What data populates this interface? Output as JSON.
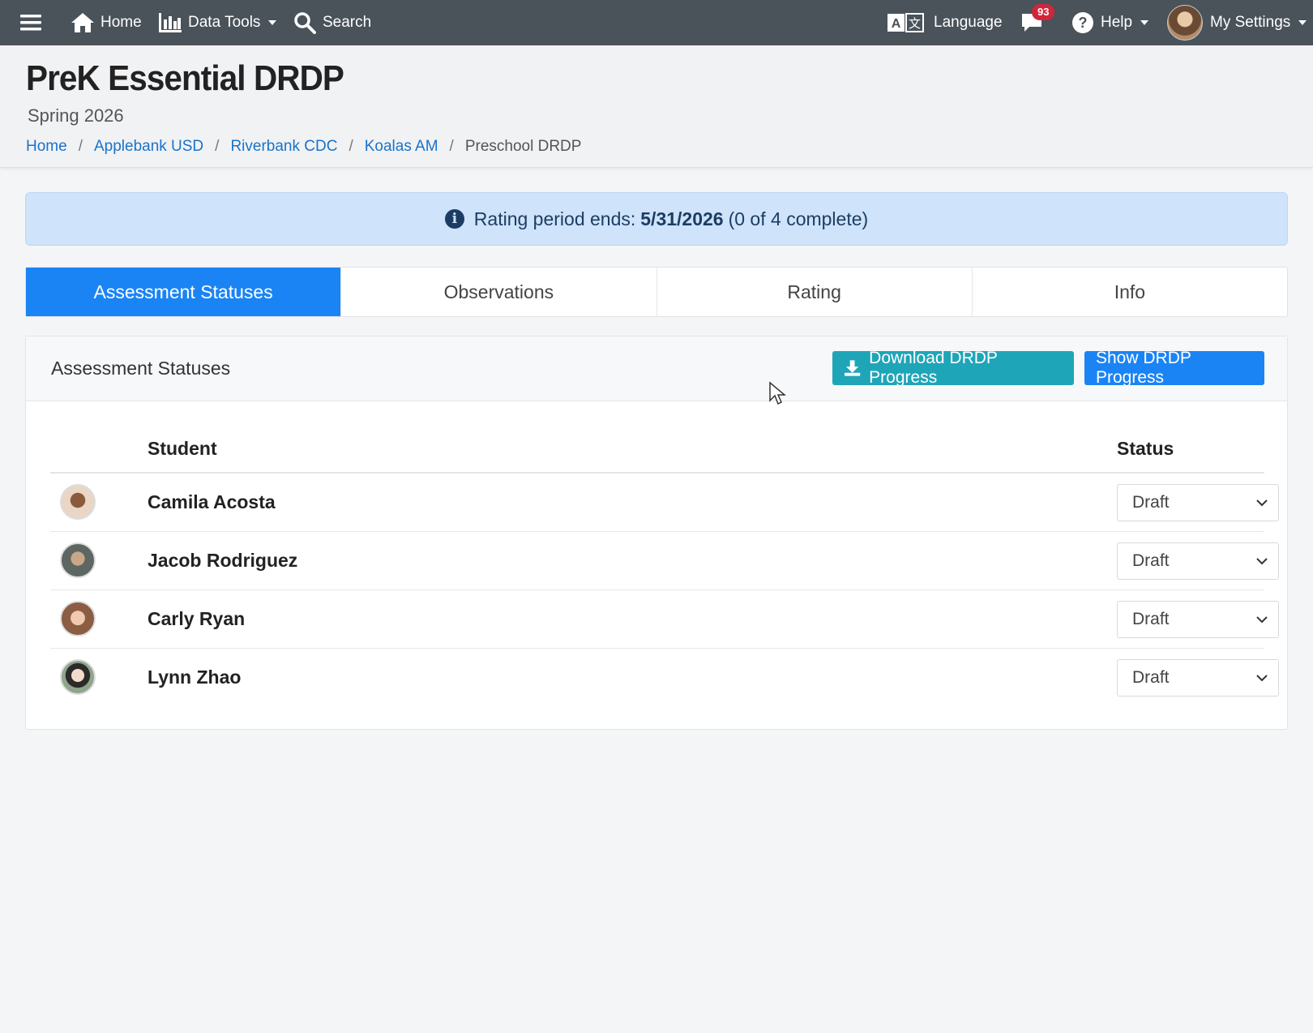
{
  "nav": {
    "home": "Home",
    "data_tools": "Data Tools",
    "search": "Search",
    "language": "Language",
    "notification_count": "93",
    "help": "Help",
    "settings": "My Settings"
  },
  "header": {
    "title": "PreK Essential DRDP",
    "subtitle": "Spring 2026",
    "breadcrumb": [
      "Home",
      "Applebank USD",
      "Riverbank CDC",
      "Koalas AM",
      "Preschool DRDP"
    ]
  },
  "alert": {
    "prefix": "Rating period ends:",
    "date": "5/31/2026",
    "suffix": "(0 of 4 complete)"
  },
  "tabs": [
    "Assessment Statuses",
    "Observations",
    "Rating",
    "Info"
  ],
  "card": {
    "title": "Assessment Statuses",
    "download_button": "Download DRDP Progress",
    "show_button": "Show DRDP Progress"
  },
  "table": {
    "columns": [
      "Student",
      "Status"
    ],
    "rows": [
      {
        "name": "Camila Acosta",
        "status": "Draft"
      },
      {
        "name": "Jacob Rodriguez",
        "status": "Draft"
      },
      {
        "name": "Carly Ryan",
        "status": "Draft"
      },
      {
        "name": "Lynn Zhao",
        "status": "Draft"
      }
    ]
  },
  "colors": {
    "nav_bg": "#4a525a",
    "primary": "#1a84f5",
    "teal": "#1fa5b8",
    "alert_bg": "#cfe3fb",
    "badge": "#d0263b"
  }
}
